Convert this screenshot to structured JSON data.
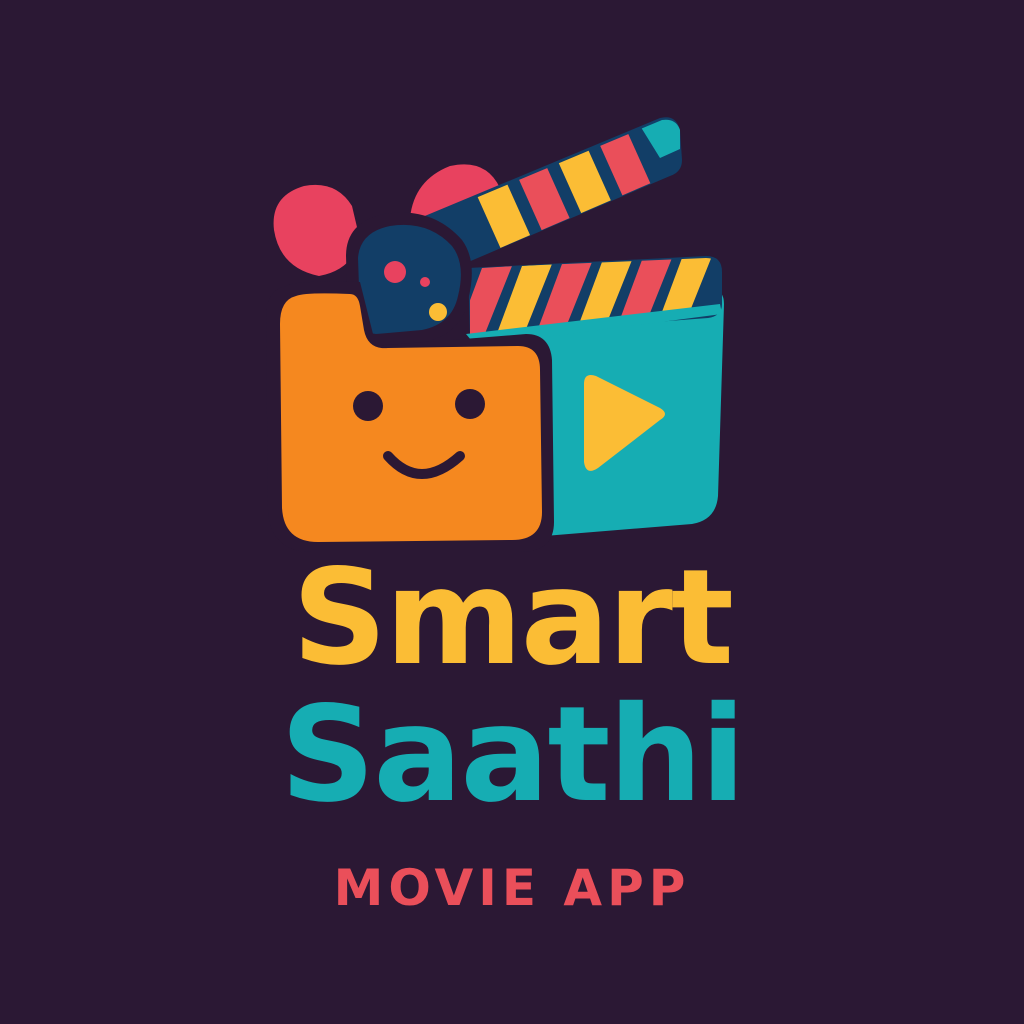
{
  "brand": {
    "name_line_1": "Smart",
    "name_line_2": "Saathi",
    "tagline": "MOVIE APP"
  },
  "logo": {
    "icon_name": "smiling-clapperboard-icon",
    "parts": [
      "film-reel-icon",
      "clapper-stick-icon",
      "smiley-face-icon",
      "play-icon"
    ]
  },
  "colors": {
    "background": "#2b1834",
    "line_1": "#fbbd35",
    "line_2": "#16adb3",
    "tagline": "#ea4f5a",
    "orange": "#f5881f",
    "teal": "#16adb3",
    "navy": "#123e67",
    "pink": "#e8425f",
    "yellow": "#fbbd35",
    "coral": "#ea4f5a",
    "dark": "#2b1834"
  }
}
